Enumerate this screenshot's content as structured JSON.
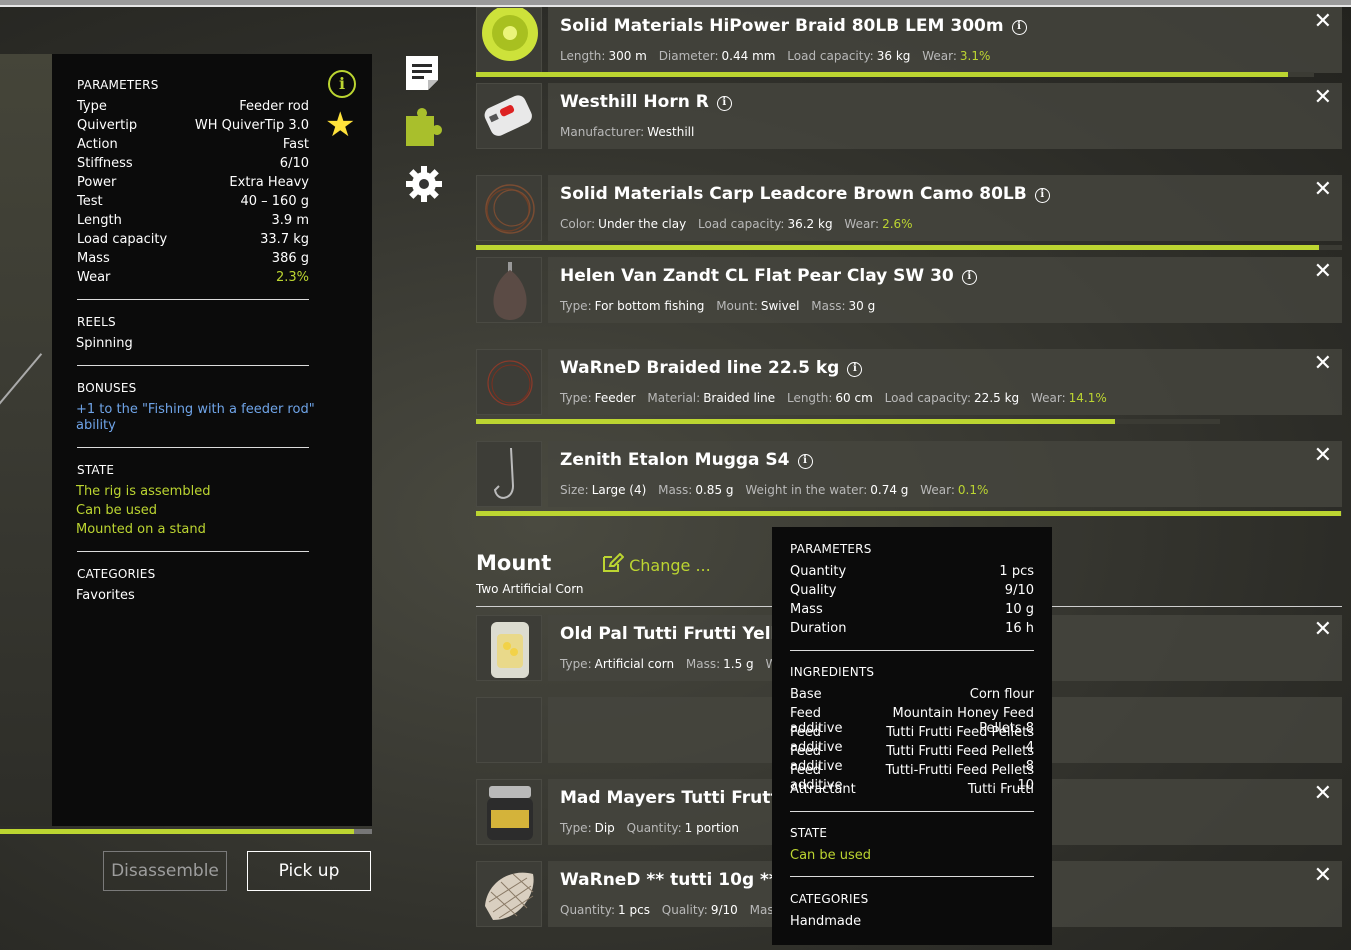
{
  "rod": {
    "parameters_title": "PARAMETERS",
    "parameters": [
      {
        "k": "Type",
        "v": "Feeder rod"
      },
      {
        "k": "Quivertip",
        "v": "WH QuiverTip 3.0"
      },
      {
        "k": "Action",
        "v": "Fast"
      },
      {
        "k": "Stiffness",
        "v": "6/10"
      },
      {
        "k": "Power",
        "v": "Extra Heavy"
      },
      {
        "k": "Test",
        "v": "40 – 160 g"
      },
      {
        "k": "Length",
        "v": "3.9 m"
      },
      {
        "k": "Load capacity",
        "v": "33.7 kg"
      },
      {
        "k": "Mass",
        "v": "386 g"
      },
      {
        "k": "Wear",
        "v": "2.3%"
      }
    ],
    "reels_title": "REELS",
    "reels_value": "Spinning",
    "bonuses_title": "BONUSES",
    "bonus_line1": "+1 to the \"Fishing with a feeder rod\"",
    "bonus_line2": "ability",
    "state_title": "STATE",
    "state": [
      "The rig is assembled",
      "Can be used",
      "Mounted on a stand"
    ],
    "categories_title": "CATEGORIES",
    "categories_value": "Favorites",
    "info_glyph": "i",
    "star_glyph": "★",
    "wear_progress": 0.952
  },
  "buttons": {
    "disassemble": "Disassemble",
    "pickup": "Pick up"
  },
  "icons": [
    "document-icon",
    "puzzle-icon",
    "gear-icon"
  ],
  "items": [
    {
      "title": "Solid Materials HiPower Braid 80LB LEM 300m",
      "props": [
        [
          "Length:",
          "300 m"
        ],
        [
          "Diameter:",
          "0.44 mm"
        ],
        [
          "Load capacity:",
          "36 kg"
        ]
      ],
      "wear_label": "Wear:",
      "wear": "3.1%",
      "bar": 0.969
    },
    {
      "title": "Westhill Horn R",
      "props": [
        [
          "Manufacturer:",
          "Westhill"
        ]
      ]
    },
    {
      "title": "Solid Materials Carp Leadcore Brown Camo 80LB",
      "props": [
        [
          "Color:",
          "Under the clay"
        ],
        [
          "Load capacity:",
          "36.2 kg"
        ]
      ],
      "wear_label": "Wear:",
      "wear": "2.6%",
      "bar": 0.974
    },
    {
      "title": "Helen Van Zandt CL Flat Pear Clay SW 30",
      "props": [
        [
          "Type:",
          "For bottom fishing"
        ],
        [
          "Mount:",
          "Swivel"
        ],
        [
          "Mass:",
          "30 g"
        ]
      ]
    },
    {
      "title": "WaRneD Braided line 22.5 kg",
      "props": [
        [
          "Type:",
          "Feeder"
        ],
        [
          "Material:",
          "Braided line"
        ],
        [
          "Length:",
          "60 cm"
        ],
        [
          "Load capacity:",
          "22.5 kg"
        ]
      ],
      "wear_label": "Wear:",
      "wear": "14.1%",
      "bar": 0.859
    },
    {
      "title": "Zenith Etalon Mugga S4",
      "props": [
        [
          "Size:",
          "Large (4)"
        ],
        [
          "Mass:",
          "0.85 g"
        ],
        [
          "Weight in the water:",
          "0.74 g"
        ]
      ],
      "wear_label": "Wear:",
      "wear": "0.1%",
      "bar": 0.999
    }
  ],
  "mount": {
    "title": "Mount",
    "subtitle": "Two Artificial Corn",
    "change_label": "Change ...",
    "items": [
      {
        "title": "Old Pal Tutti Frutti Yellow",
        "props": [
          [
            "Type:",
            "Artificial corn"
          ],
          [
            "Mass:",
            "1.5 g"
          ]
        ],
        "trail": "Wei"
      },
      {
        "title": "Mad Mayers Tutti Frutti",
        "props": [
          [
            "Type:",
            "Dip"
          ],
          [
            "Quantity:",
            "1 portion"
          ]
        ]
      },
      {
        "title": "WaRneD ** tutti 10g **",
        "props": [
          [
            "Quantity:",
            "1 pcs"
          ],
          [
            "Quality:",
            "9/10"
          ]
        ],
        "trail": "Mass:"
      }
    ]
  },
  "close_glyph": "✕",
  "tooltip": {
    "parameters_title": "PARAMETERS",
    "parameters": [
      {
        "k": "Quantity",
        "v": "1 pcs"
      },
      {
        "k": "Quality",
        "v": "9/10"
      },
      {
        "k": "Mass",
        "v": "10 g"
      },
      {
        "k": "Duration",
        "v": "16 h"
      }
    ],
    "ingredients_title": "INGREDIENTS",
    "ingredients": [
      {
        "k": "Base",
        "v": "Corn flour"
      },
      {
        "k": "Feed additive",
        "v": "Mountain Honey Feed Pellets 8"
      },
      {
        "k": "Feed additive",
        "v": "Tutti Frutti Feed Pellets 4"
      },
      {
        "k": "Feed additive",
        "v": "Tutti Frutti Feed Pellets 8"
      },
      {
        "k": "Feed additive",
        "v": "Tutti-Frutti Feed Pellets 10"
      },
      {
        "k": "Attractant",
        "v": "Tutti Frutti"
      }
    ],
    "state_title": "STATE",
    "state_value": "Can be used",
    "categories_title": "CATEGORIES",
    "categories_value": "Handmade"
  },
  "colors": {
    "accent": "#bcd531",
    "bonus": "#6fa4e8",
    "star": "#ffe23b"
  }
}
